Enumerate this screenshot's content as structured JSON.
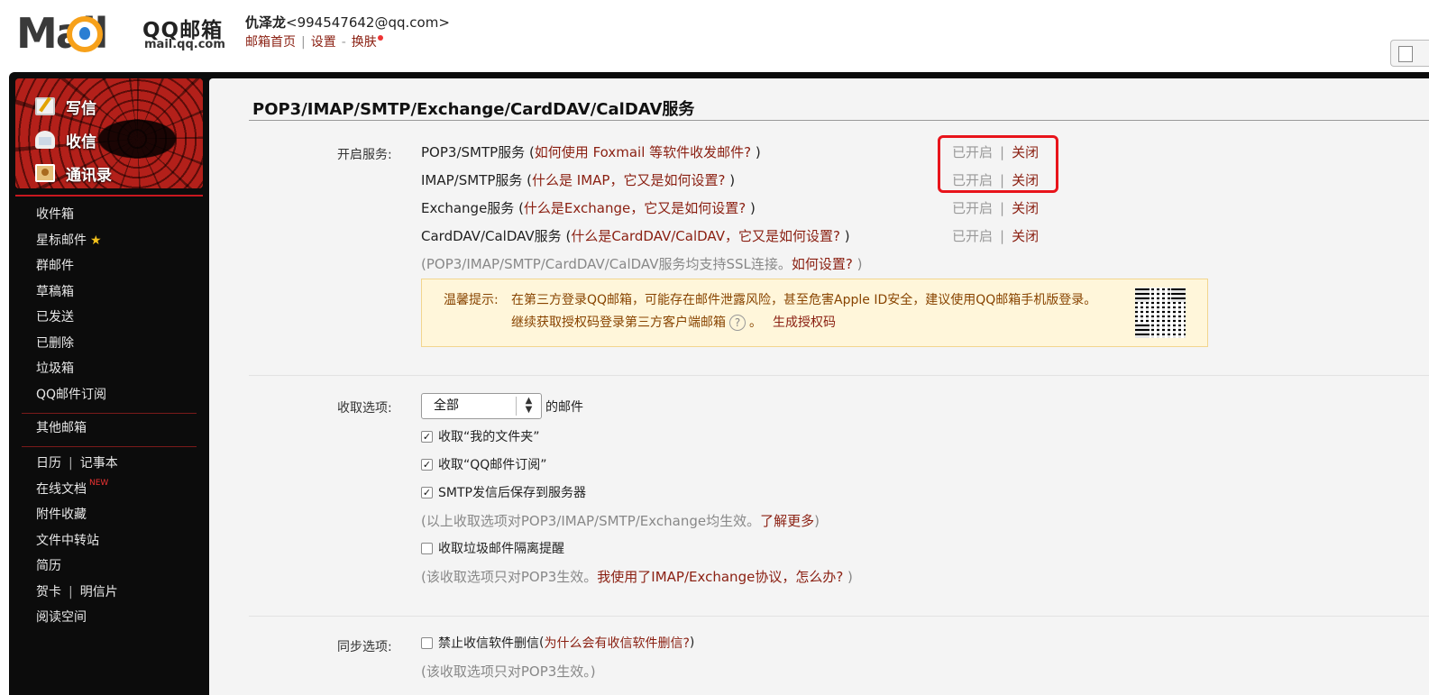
{
  "header": {
    "brand": "QQ邮箱",
    "brand_url": "mail.qq.com",
    "logo_word": "Mail",
    "user_name": "仇泽龙",
    "user_email": "<994547642@qq.com>",
    "links": {
      "home": "邮箱首页",
      "settings": "设置",
      "skin": "换肤"
    }
  },
  "sidebar": {
    "compose": "写信",
    "inbox": "收信",
    "contacts": "通讯录",
    "folders": [
      "收件箱",
      "星标邮件",
      "群邮件",
      "草稿箱",
      "已发送",
      "已删除",
      "垃圾箱",
      "QQ邮件订阅"
    ],
    "other_mail": "其他邮箱",
    "tools": {
      "calendar": "日历",
      "notes": "记事本",
      "docs": "在线文档",
      "docs_badge": "NEW",
      "attachments": "附件收藏",
      "transfer": "文件中转站",
      "resume": "简历",
      "card": "贺卡",
      "postcard": "明信片",
      "reading": "阅读空间"
    }
  },
  "main": {
    "title": "POP3/IMAP/SMTP/Exchange/CardDAV/CalDAV服务",
    "services_label": "开启服务:",
    "services": [
      {
        "name": "POP3/SMTP服务",
        "open": " (",
        "link": "如何使用 Foxmail 等软件收发邮件?",
        "close": " )",
        "status": "已开启",
        "sep": "|",
        "action": "关闭"
      },
      {
        "name": "IMAP/SMTP服务",
        "open": " (",
        "link": "什么是 IMAP，它又是如何设置?",
        "close": " )",
        "status": "已开启",
        "sep": "|",
        "action": "关闭"
      },
      {
        "name": "Exchange服务",
        "open": " (",
        "link": "什么是Exchange，它又是如何设置?",
        "close": " )",
        "status": "已开启",
        "sep": "|",
        "action": "关闭"
      },
      {
        "name": "CardDAV/CalDAV服务",
        "open": " (",
        "link": "什么是CardDAV/CalDAV，它又是如何设置?",
        "close": " )",
        "status": "已开启",
        "sep": "|",
        "action": "关闭"
      }
    ],
    "ssl_note": {
      "prefix": "(POP3/IMAP/SMTP/CardDAV/CalDAV服务均支持SSL连接。",
      "link": "如何设置?",
      "suffix": " )"
    },
    "tip": {
      "lead": "温馨提示:",
      "line1": "在第三方登录QQ邮箱，可能存在邮件泄露风险，甚至危害Apple ID安全，建议使用QQ邮箱手机版登录。",
      "line2": "继续获取授权码登录第三方客户端邮箱",
      "help": "?",
      "line2_end": "。",
      "action": "生成授权码"
    },
    "fetch_label": "收取选项:",
    "fetch_select": "全部",
    "fetch_suffix": "的邮件",
    "fetch_options": [
      {
        "label": "收取“我的文件夹”",
        "checked": true
      },
      {
        "label": "收取“QQ邮件订阅”",
        "checked": true
      },
      {
        "label": "SMTP发信后保存到服务器",
        "checked": true
      }
    ],
    "fetch_note": {
      "prefix": "(以上收取选项对POP3/IMAP/SMTP/Exchange均生效。",
      "link": "了解更多",
      "suffix": ")"
    },
    "spam_option": {
      "label": "收取垃圾邮件隔离提醒",
      "checked": false
    },
    "spam_note": {
      "prefix": "(该收取选项只对POP3生效。",
      "link": "我使用了IMAP/Exchange协议，怎么办?",
      "suffix": " )"
    },
    "sync_label": "同步选项:",
    "sync_option": {
      "label": "禁止收信软件删信",
      "checked": false,
      "open": " (",
      "link": "为什么会有收信软件删信?",
      "close": " )"
    },
    "sync_note": "(该收取选项只对POP3生效。)"
  },
  "colors": {
    "link": "#8a1f11",
    "highlight": "#e8141b",
    "tip_bg": "#fff6da",
    "sidebar_bg": "#0c0c0c"
  }
}
